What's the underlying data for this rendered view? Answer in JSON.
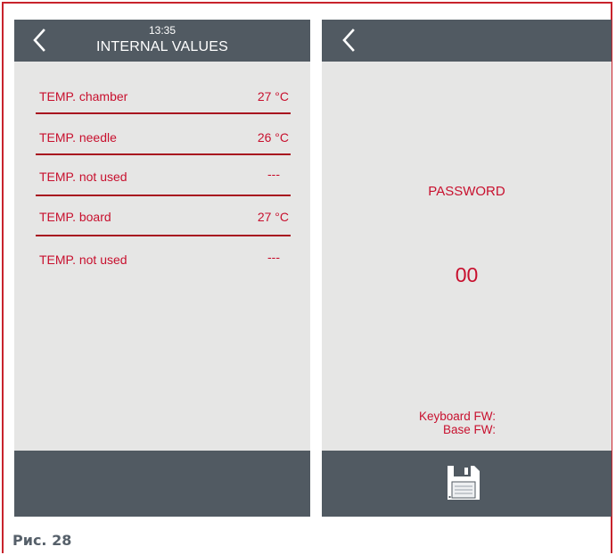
{
  "left_screen": {
    "time": "13:35",
    "title": "INTERNAL VALUES",
    "rows": [
      {
        "label": "TEMP. chamber",
        "value": "27 °C"
      },
      {
        "label": "TEMP. needle",
        "value": "26 °C"
      },
      {
        "label": "TEMP. not used",
        "value": "---"
      },
      {
        "label": "TEMP. board",
        "value": "27 °C"
      },
      {
        "label": "TEMP. not used",
        "value": "---"
      }
    ]
  },
  "right_screen": {
    "password_label": "PASSWORD",
    "password_value": "00",
    "keyboard_fw_label": "Keyboard FW:",
    "base_fw_label": "Base FW:"
  },
  "caption": "Рис. 28",
  "icons": {
    "back": "chevron-left-icon",
    "save": "floppy-disk-icon"
  },
  "colors": {
    "accent": "#c8102e",
    "bar": "#515a62",
    "screen_bg": "#e6e6e5"
  }
}
